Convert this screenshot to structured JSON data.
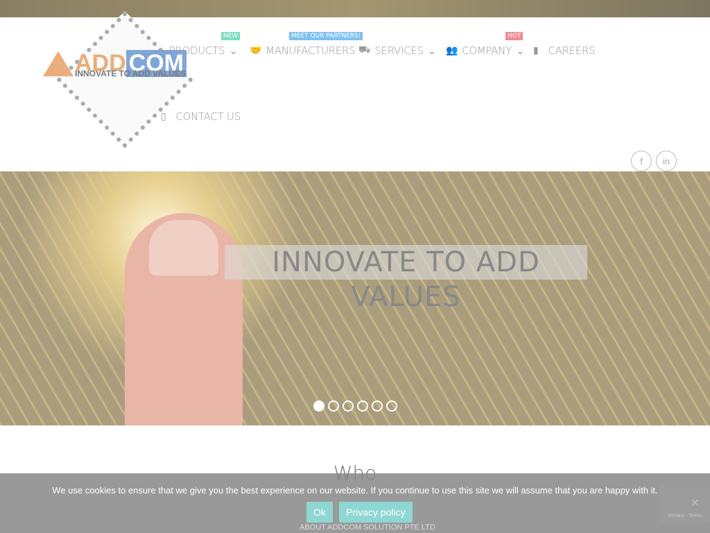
{
  "logo": {
    "add": "ADD",
    "com": "COM",
    "tagline": "INNOVATE TO ADD VALUES"
  },
  "nav": [
    {
      "label": "PRODUCTS",
      "icon": "chip-icon",
      "badge": "NEW",
      "badge_color": "#7fdcc0",
      "dropdown": true
    },
    {
      "label": "MANUFACTURERS",
      "icon": "handshake-icon",
      "badge": "MEET OUR PARTNERS!",
      "badge_color": "#7ec1ef"
    },
    {
      "label": "SERVICES",
      "icon": "truck-icon",
      "dropdown": true
    },
    {
      "label": "COMPANY",
      "icon": "users-icon",
      "badge": "HOT",
      "badge_color": "#f08a93",
      "dropdown": true
    },
    {
      "label": "CAREERS",
      "icon": "tie-icon"
    },
    {
      "label": "CONTACT US",
      "icon": "mobile-icon"
    }
  ],
  "social": {
    "facebook": "f",
    "linkedin": "in"
  },
  "hero": {
    "title": "INNOVATE TO ADD VALUES",
    "slides": 6,
    "active_slide": 1
  },
  "section": {
    "title": "Who",
    "subtitle": "ABOUT ADDCOM SOLUTION PTE LTD"
  },
  "cookie": {
    "text": "We use cookies to ensure that we give you the best experience on our website. If you continue to use this site we will assume that you are happy with it.",
    "ok": "Ok",
    "privacy": "Privacy policy",
    "close": "×"
  },
  "recaptcha": {
    "text": "Privacy - Terms"
  }
}
